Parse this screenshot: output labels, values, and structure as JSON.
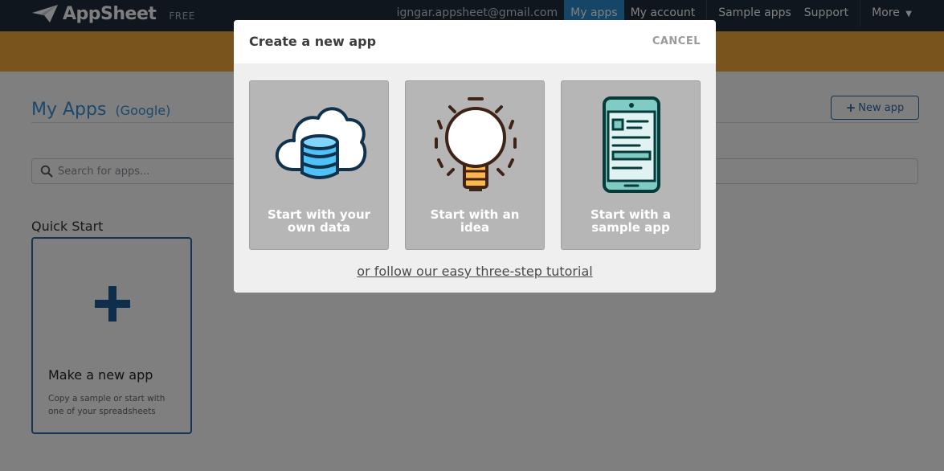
{
  "topnav": {
    "brand": "AppSheet",
    "plan": "FREE",
    "email": "igngar.appsheet@gmail.com",
    "items": [
      {
        "label": "My apps"
      },
      {
        "label": "My account"
      },
      {
        "label": "Sample apps"
      },
      {
        "label": "Support"
      },
      {
        "label": "More"
      }
    ],
    "icons": {
      "logo": "paper-plane-icon",
      "more": "caret-down-icon"
    }
  },
  "page": {
    "title": "My Apps",
    "title_sub": "(Google)",
    "new_app_label": "New app",
    "search_placeholder": "Search for apps...",
    "quick_start_label": "Quick Start",
    "quick_start_card": {
      "title": "Make a new app",
      "description": "Copy a sample or start with one of your spreadsheets"
    }
  },
  "modal": {
    "title": "Create a new app",
    "cancel": "CANCEL",
    "options": [
      {
        "label_line1": "Start with your",
        "label_line2": "own data",
        "icon": "cloud-database-icon"
      },
      {
        "label_line1": "Start with an",
        "label_line2": "idea",
        "icon": "lightbulb-icon"
      },
      {
        "label_line1": "Start with a",
        "label_line2": "sample app",
        "icon": "mobile-app-icon"
      }
    ],
    "tutorial_link": "or follow our easy three-step tutorial"
  },
  "colors": {
    "nav_bg": "#1f2d3a",
    "accent": "#3593d8",
    "banner": "#f2a93b",
    "card_bg": "#b6b6b6",
    "cloud_blue": "#4fc3f7",
    "bulb_yellow": "#ffb74d",
    "phone_teal": "#80cbc4"
  }
}
